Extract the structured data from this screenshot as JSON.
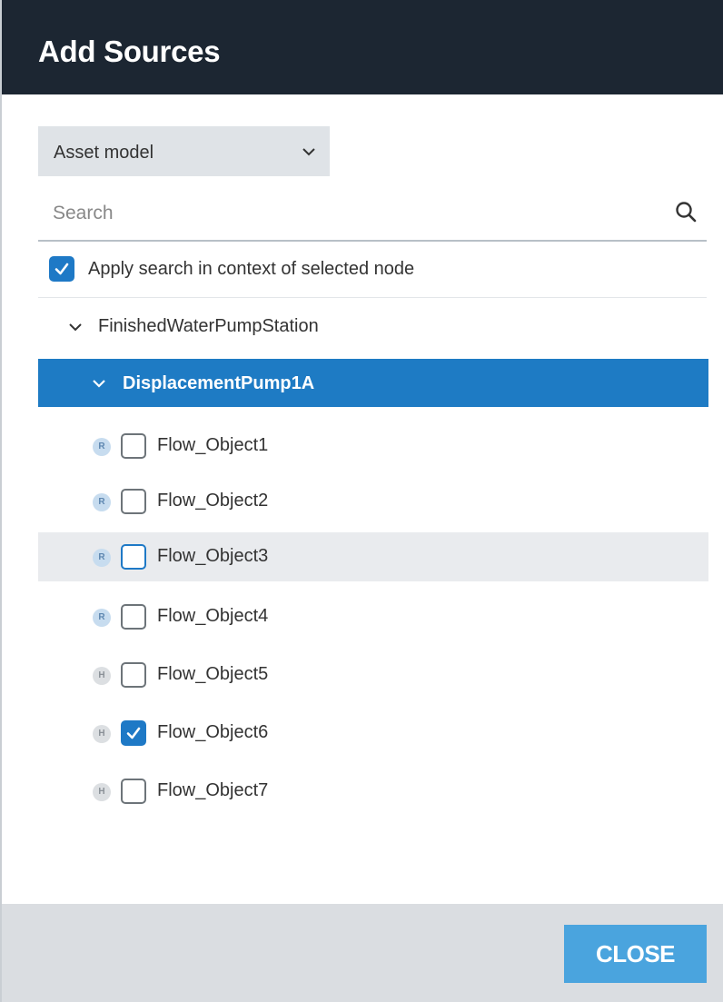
{
  "dialog": {
    "title": "Add Sources",
    "close_label": "CLOSE"
  },
  "source_select": {
    "value": "Asset model",
    "icon": "chevron-down-icon"
  },
  "search": {
    "placeholder": "Search",
    "value": "",
    "icon": "search-icon"
  },
  "apply_context": {
    "label": "Apply search in context of selected node",
    "checked": true
  },
  "tree": {
    "root": {
      "label": "FinishedWaterPumpStation",
      "expanded": true
    },
    "selected_node": {
      "label": "DisplacementPump1A",
      "expanded": true
    },
    "items": [
      {
        "badge": "R",
        "label": "Flow_Object1",
        "checked": false
      },
      {
        "badge": "R",
        "label": "Flow_Object2",
        "checked": false
      },
      {
        "badge": "R",
        "label": "Flow_Object3",
        "checked": false,
        "hovered": true
      },
      {
        "badge": "R",
        "label": "Flow_Object4",
        "checked": false
      },
      {
        "badge": "H",
        "label": "Flow_Object5",
        "checked": false
      },
      {
        "badge": "H",
        "label": "Flow_Object6",
        "checked": true
      },
      {
        "badge": "H",
        "label": "Flow_Object7",
        "checked": false
      }
    ]
  },
  "colors": {
    "header_bg": "#1c2632",
    "selected_row": "#1e7bc4",
    "checkbox_checked": "#1e79c6",
    "close_button": "#4aa4de",
    "footer_bg": "#dadde1"
  }
}
